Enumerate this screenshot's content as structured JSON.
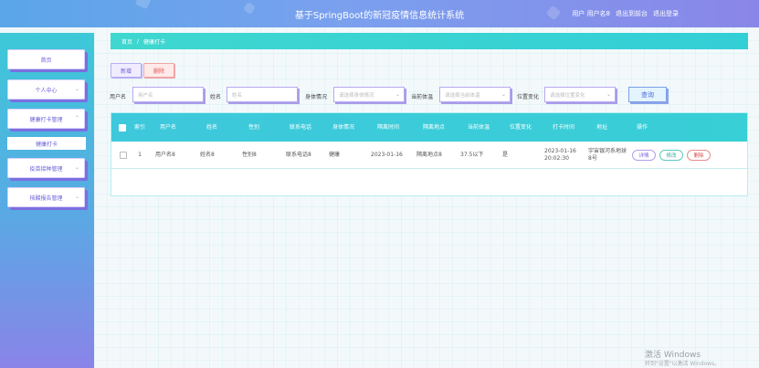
{
  "header": {
    "title": "基于SpringBoot的新冠疫情信息统计系统",
    "user_label": "用户 用户名8",
    "goto_admin": "退出到前台",
    "logout": "退出登录"
  },
  "sidebar": {
    "items": [
      {
        "label": "首页"
      },
      {
        "label": "个人中心"
      },
      {
        "label": "健康打卡管理"
      },
      {
        "label": "疫苗接种管理"
      },
      {
        "label": "核酸报告管理"
      }
    ],
    "subitem": "健康打卡"
  },
  "breadcrumb": {
    "home": "首页",
    "separator": "/",
    "current": "健康打卡"
  },
  "toolbar": {
    "add": "新增",
    "delete": "删除",
    "search": "查询"
  },
  "filters": {
    "username": {
      "label": "用户名",
      "placeholder": "用户名"
    },
    "name": {
      "label": "姓名",
      "placeholder": "姓名"
    },
    "health": {
      "label": "身体情况",
      "placeholder": "请选择身体情况"
    },
    "temp": {
      "label": "当前体温",
      "placeholder": "请选择当前体温"
    },
    "location": {
      "label": "位置变化",
      "placeholder": "请选择位置变化"
    }
  },
  "table": {
    "headers": [
      "索引",
      "用户名",
      "姓名",
      "性别",
      "联系电话",
      "身体情况",
      "隔离时间",
      "隔离地点",
      "当前体温",
      "位置变化",
      "打卡时间",
      "地址",
      "操作"
    ],
    "rows": [
      {
        "index": "1",
        "username": "用户名8",
        "name": "姓名8",
        "gender": "性别8",
        "phone": "联系电话8",
        "health": "健康",
        "isolation_time": "2023-01-16",
        "isolation_place": "隔离地点8",
        "temperature": "37.5以下",
        "location_change": "是",
        "checkin_time": "2023-01-16 20:02:30",
        "address": "宇宙银河系地球8号",
        "actions": {
          "detail": "详情",
          "edit": "修改",
          "delete": "删除"
        }
      }
    ]
  },
  "watermark": {
    "title": "激活 Windows",
    "subtitle": "转到\"设置\"以激活 Windows。"
  }
}
